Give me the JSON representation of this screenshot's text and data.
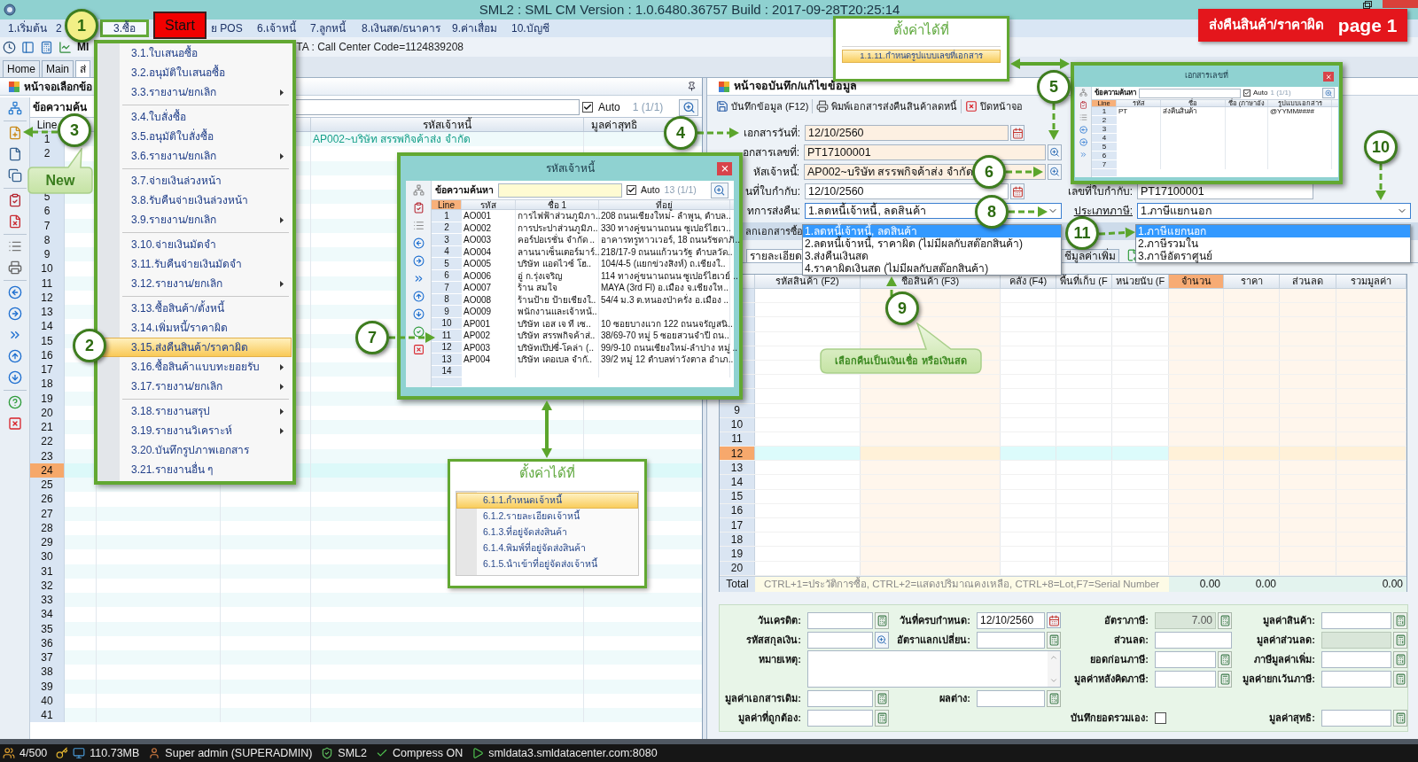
{
  "window": {
    "title": "SML2 : SML CM Version : 1.0.6480.36757 Build : 2017-09-28T20:25:14"
  },
  "menu_bar": [
    {
      "label": "1.เริ่มต้น",
      "selected": false
    },
    {
      "label": "2",
      "selected": false
    },
    {
      "label": "3.ซื้อ",
      "selected": true
    },
    {
      "label": "ย POS",
      "selected": false
    },
    {
      "label": "6.เจ้าหนี้",
      "selected": false
    },
    {
      "label": "7.ลูกหนี้",
      "selected": false
    },
    {
      "label": "8.เงินสด/ธนาคาร",
      "selected": false
    },
    {
      "label": "9.ค่าเสื่อม",
      "selected": false
    },
    {
      "label": "10.บัญชี",
      "selected": false
    }
  ],
  "toolbar": {
    "label": "MI",
    "info": "TA : Call Center Code=1124839208"
  },
  "tabs": [
    {
      "label": "Home",
      "selected": false
    },
    {
      "label": "Main",
      "selected": false
    },
    {
      "label": "ส่",
      "selected": true
    }
  ],
  "purchase_menu": [
    [
      {
        "label": "3.1.ใบเสนอซื้อ",
        "submenu": false,
        "selected": false
      },
      {
        "label": "3.2.อนุมัติใบเสนอซื้อ",
        "submenu": false,
        "selected": false
      },
      {
        "label": "3.3.รายงาน/ยกเลิก",
        "submenu": true,
        "selected": false
      }
    ],
    [
      {
        "label": "3.4.ใบสั่งซื้อ",
        "submenu": false,
        "selected": false
      },
      {
        "label": "3.5.อนุมัติใบสั่งซื้อ",
        "submenu": false,
        "selected": false
      },
      {
        "label": "3.6.รายงาน/ยกเลิก",
        "submenu": true,
        "selected": false
      }
    ],
    [
      {
        "label": "3.7.จ่ายเงินล่วงหน้า",
        "submenu": false,
        "selected": false
      },
      {
        "label": "3.8.รับคืนจ่ายเงินล่วงหน้า",
        "submenu": false,
        "selected": false
      },
      {
        "label": "3.9.รายงาน/ยกเลิก",
        "submenu": true,
        "selected": false
      }
    ],
    [
      {
        "label": "3.10.จ่ายเงินมัดจำ",
        "submenu": false,
        "selected": false
      },
      {
        "label": "3.11.รับคืนจ่ายเงินมัดจำ",
        "submenu": false,
        "selected": false
      },
      {
        "label": "3.12.รายงาน/ยกเลิก",
        "submenu": true,
        "selected": false
      }
    ],
    [
      {
        "label": "3.13.ซื้อสินค้า/ตั้งหนี้",
        "submenu": false,
        "selected": false
      },
      {
        "label": "3.14.เพิ่มหนี้/ราคาผิด",
        "submenu": false,
        "selected": false
      },
      {
        "label": "3.15.ส่งคืนสินค้า/ราคาผิด",
        "submenu": false,
        "selected": true
      },
      {
        "label": "3.16.ซื้อสินค้าแบบทะยอยรับ",
        "submenu": true,
        "selected": false
      },
      {
        "label": "3.17.รายงาน/ยกเลิก",
        "submenu": true,
        "selected": false
      }
    ],
    [
      {
        "label": "3.18.รายงานสรุป",
        "submenu": true,
        "selected": false
      },
      {
        "label": "3.19.รายงานวิเคราะห์",
        "submenu": true,
        "selected": false
      },
      {
        "label": "3.20.บันทึกรูปภาพเอกสาร",
        "submenu": false,
        "selected": false
      },
      {
        "label": "3.21.รายงานอื่น ๆ",
        "submenu": false,
        "selected": false
      }
    ]
  ],
  "left_panel": {
    "title": "หน้าจอเลือกข้อ",
    "search_label": "ข้อความค้น",
    "auto": {
      "label": "Auto",
      "checked": true
    },
    "count": "1 (1/1)",
    "columns": [
      "Line",
      "รหัสเจ้าหนี้",
      "มูลค่าสุทธิ"
    ],
    "rows": [
      {
        "line": "1",
        "supplier": "AP002~บริษัท สรรพกิจค้าส่ง จำกัด",
        "selected": false
      },
      {
        "line": "2",
        "selected": false
      },
      {
        "selected": false
      },
      {
        "selected": false
      },
      {
        "line": "5",
        "selected": false
      },
      {
        "line": "6",
        "selected": false
      },
      {
        "line": "7",
        "selected": false
      },
      {
        "line": "8",
        "selected": false
      },
      {
        "line": "9",
        "selected": false
      },
      {
        "line": "10",
        "selected": false
      },
      {
        "line": "11",
        "selected": false
      },
      {
        "line": "12",
        "selected": false
      },
      {
        "line": "13",
        "selected": false
      },
      {
        "line": "14",
        "selected": false
      },
      {
        "line": "15",
        "selected": false
      },
      {
        "line": "16",
        "selected": false
      },
      {
        "line": "17",
        "selected": false
      },
      {
        "line": "18",
        "selected": false
      },
      {
        "line": "19",
        "selected": false
      },
      {
        "line": "20",
        "selected": false
      },
      {
        "line": "21",
        "selected": false
      },
      {
        "line": "22",
        "selected": false
      },
      {
        "line": "23",
        "selected": false
      },
      {
        "line": "24",
        "selected": true
      },
      {
        "line": "25",
        "selected": false
      },
      {
        "line": "26",
        "selected": false
      },
      {
        "line": "27",
        "selected": false
      },
      {
        "line": "28",
        "selected": false
      },
      {
        "line": "29",
        "selected": false
      },
      {
        "line": "30",
        "selected": false
      },
      {
        "line": "31",
        "selected": false
      },
      {
        "line": "32",
        "selected": false
      },
      {
        "line": "33",
        "selected": false
      },
      {
        "line": "34",
        "selected": false
      },
      {
        "line": "35",
        "selected": false
      },
      {
        "line": "36",
        "selected": false
      },
      {
        "line": "37",
        "selected": false
      },
      {
        "line": "38",
        "selected": false
      },
      {
        "line": "39",
        "selected": false
      },
      {
        "line": "40",
        "selected": false
      },
      {
        "line": "41",
        "selected": false
      }
    ]
  },
  "editor": {
    "title": "หน้าจอบันทึก/แก้ไขข้อมูล",
    "actions": [
      {
        "label": "บันทึกข้อมูล (F12)",
        "kind": "save"
      },
      {
        "label": "พิมพ์เอกสารส่งคืนสินค้าลดหนี้",
        "kind": "print"
      },
      {
        "label": "ปิดหน้าจอ",
        "kind": "close"
      }
    ],
    "fields": [
      {
        "label": "เอกสารวันที่:",
        "value": "12/10/2560",
        "kind": "date",
        "required": true
      },
      {
        "label": "อกสารเลขที่:",
        "value": "PT17100001",
        "kind": "lookup",
        "required": true
      },
      {
        "label": "หัสเจ้าหนี้:",
        "value": "AP002~บริษัท สรรพกิจค้าส่ง จำกัด",
        "kind": "lookup",
        "required": true
      },
      {
        "label": "นที่ใบกำกับ:",
        "value": "12/10/2560",
        "kind": "date",
        "required": false
      },
      {
        "label": "ทการส่งคืน:",
        "value": "1.ลดหนี้เจ้าหนี้, ลดสินค้า",
        "kind": "dropdown",
        "required": false,
        "expanded": true,
        "options": [
          {
            "label": "1.ลดหนี้เจ้าหนี้, ลดสินค้า",
            "selected": true
          },
          {
            "label": "2.ลดหนี้เจ้าหนี้, ราคาผิด (ไม่มีผลกับสต๊อกสินค้า)",
            "selected": false
          },
          {
            "label": "3.ส่งคืนเงินสด",
            "selected": false
          },
          {
            "label": "4.ราคาผิดเงินสด (ไม่มีผลกับสต๊อกสินค้า)",
            "selected": false
          }
        ]
      }
    ],
    "invoice": {
      "label": "เลขที่ใบกำกับ:",
      "value": "PT17100001"
    },
    "tax_type": {
      "label": "ประเภทภาษี:",
      "value": "1.ภาษีแยกนอก",
      "expanded": true,
      "options": [
        {
          "label": "1.ภาษีแยกนอก",
          "selected": true
        },
        {
          "label": "2.ภาษีรวมใน",
          "selected": false
        },
        {
          "label": "3.ภาษีอัตราศูนย์",
          "selected": false
        }
      ]
    },
    "section_label": "ลกเอกสารซื้อ",
    "detail_tabs": [
      {
        "label": "รายละเอียด",
        "selected": true
      },
      {
        "label": "ชีมูลค่าเพิ่ม",
        "selected": false
      }
    ],
    "grid": {
      "columns": [
        {
          "label": "รหัสสินค้า (F2)",
          "selected": false
        },
        {
          "label": "ชื่อสินค้า (F3)",
          "selected": false
        },
        {
          "label": "คลัง (F4)",
          "selected": false
        },
        {
          "label": "พื้นที่เก็บ (F",
          "selected": false
        },
        {
          "label": "หน่วยนับ (F",
          "selected": false
        },
        {
          "label": "จำนวน",
          "selected": true
        },
        {
          "label": "ราคา",
          "selected": false
        },
        {
          "label": "ส่วนลด",
          "selected": false
        },
        {
          "label": "รวมมูลค่า",
          "selected": false
        }
      ],
      "rows": [
        {
          "selected": false
        },
        {
          "selected": false
        },
        {
          "selected": false
        },
        {
          "selected": false
        },
        {
          "selected": false
        },
        {
          "selected": false
        },
        {
          "selected": false
        },
        {
          "selected": false
        },
        {
          "line": "9",
          "selected": false
        },
        {
          "line": "10",
          "selected": false
        },
        {
          "line": "11",
          "selected": false
        },
        {
          "line": "12",
          "selected": true
        },
        {
          "line": "13",
          "selected": false
        },
        {
          "line": "14",
          "selected": false
        },
        {
          "line": "15",
          "selected": false
        },
        {
          "line": "16",
          "selected": false
        },
        {
          "line": "17",
          "selected": false
        },
        {
          "line": "18",
          "selected": false
        },
        {
          "line": "19",
          "selected": false
        },
        {
          "line": "20",
          "selected": false
        }
      ],
      "total": {
        "label": "Total",
        "hint": "CTRL+1=ประวัติการซื้อ, CTRL+2=แสดงปริมาณคงเหลือ, CTRL+8=Lot,F7=Serial Number",
        "quantity": "0.00",
        "price": "0.00",
        "amount": "0.00"
      }
    },
    "summary": [
      {
        "label": "วันเครดิต:",
        "kind": "calc",
        "disabled": false
      },
      {
        "label": "วันที่ครบกำหนด:",
        "kind": "date",
        "value": "12/10/2560",
        "disabled": false
      },
      {
        "label": "อัตราภาษี:",
        "kind": "calc",
        "value": "7.00",
        "disabled": true
      },
      {
        "label": "มูลค่าสินค้า:",
        "kind": "calc",
        "disabled": false
      },
      {
        "label": "รหัสสกุลเงิน:",
        "kind": "search",
        "disabled": false
      },
      {
        "label": "อัตราแลกเปลี่ยน:",
        "kind": "calc",
        "disabled": false
      },
      {
        "label": "ส่วนลด:",
        "kind": "plain",
        "disabled": false
      },
      {
        "label": "มูลค่าส่วนลด:",
        "kind": "calc",
        "disabled": true
      },
      {
        "label": "หมายเหตุ:",
        "kind": "textarea",
        "disabled": false
      },
      {
        "label": "ยอดก่อนภาษี:",
        "kind": "calc",
        "disabled": false
      },
      {
        "label": "ภาษีมูลค่าเพิ่ม:",
        "kind": "calc",
        "disabled": false
      },
      {
        "label": "มูลค่าหลังคิดภาษี:",
        "kind": "calc",
        "disabled": false
      },
      {
        "label": "มูลค่ายกเว้นภาษี:",
        "kind": "calc",
        "disabled": false
      },
      {
        "label": "มูลค่าเอกสารเดิม:",
        "kind": "calc",
        "disabled": false
      },
      {
        "label": "ผลต่าง:",
        "kind": "calc",
        "disabled": false
      },
      {
        "label": "มูลค่าที่ถูกต้อง:",
        "kind": "calc",
        "disabled": false
      },
      {
        "label": "บันทึกยอดรวมเอง:",
        "kind": "checkbox",
        "checked": false,
        "disabled": false
      },
      {
        "label": "มูลค่าสุทธิ:",
        "kind": "calc",
        "disabled": false
      }
    ]
  },
  "lookup_windows": [
    {
      "title": "รหัสเจ้าหนี้",
      "search_label": "ข้อความค้นหา",
      "auto": {
        "label": "Auto",
        "checked": true
      },
      "count": "13 (1/1)",
      "columns": [
        "Line",
        "รหัส",
        "ชื่อ 1",
        "ที่อยู่"
      ],
      "rows": [
        {
          "line": "1",
          "code": "AO001",
          "name": "การไฟฟ้าส่วนภูมิภา..",
          "address": "208 ถนนเชียงใหม่- ลำพูน, ตำบล.."
        },
        {
          "line": "2",
          "code": "AO002",
          "name": "การประปาส่วนภูมิภ..",
          "address": "330 ทางคู่ขนานถนน ซูเปอร์ไฮเว.."
        },
        {
          "line": "3",
          "code": "AO003",
          "name": "คอร์ปอเรชั่น จำกัด ..",
          "address": "อาคารทรูทาวเวอร์, 18 ถนนรัชดาภิ.."
        },
        {
          "line": "4",
          "code": "AO004",
          "name": "ลานนาเซ็นเตอร์มาร์..",
          "address": "218/17-9 ถนนแก้วนวรัฐ ตำบลวัด.."
        },
        {
          "line": "5",
          "code": "AO005",
          "name": "บริษัท แอดไวซ์ โฮ..",
          "address": "104/4-5 (แยกข่วงสิงห์) ถ.เชียงใ.."
        },
        {
          "line": "6",
          "code": "AO006",
          "name": "อู่ ก.รุ่งเจริญ",
          "address": "114 ทางคู่ขนานถนน ซูเปอร์ไฮเวย์ .."
        },
        {
          "line": "7",
          "code": "AO007",
          "name": "ร้าน สมใจ",
          "address": "MAYA (3rd Fl) อ.เมือง จ.เชียงให.."
        },
        {
          "line": "8",
          "code": "AO008",
          "name": "ร้านป้าย ป้ายเชียงใ..",
          "address": "54/4 ม.3 ต.หนองป่าครั่ง อ.เมือง .."
        },
        {
          "line": "9",
          "code": "AO009",
          "name": "พนักงานและเจ้าหน้.."
        },
        {
          "line": "10",
          "code": "AP001",
          "name": "บริษัท เอส เจ ที เซ..",
          "address": "10 ซอยบางแวก 122 ถนนจรัญสนิ.."
        },
        {
          "line": "11",
          "code": "AP002",
          "name": "บริษัท สรรพกิจค้าส่..",
          "address": "38/69-70 หมู่ 5 ซอยสวนจำปี ถน.."
        },
        {
          "line": "12",
          "code": "AP003",
          "name": "บริษัทเป๊ปซี่-โคล่า (..",
          "address": "99/9-10 ถนนเชียงใหม่-ลำปาง หมู่ .."
        },
        {
          "line": "13",
          "code": "AP004",
          "name": "บริษัท เดอเบล จำกั..",
          "address": "39/2 หมู่ 12 ตำบลท่าวังตาล อำเภ.."
        },
        {
          "line": "14"
        }
      ]
    },
    {
      "title": "เอกสารเลขที่",
      "search_label": "ข้อความค้นหา",
      "auto": {
        "label": "Auto",
        "checked": true
      },
      "count": "1 (1/1)",
      "columns": [
        "Line",
        "รหัส",
        "ชื่อ",
        "ชื่อ (ภาษาอัง",
        "รูปแบบเอกสาร"
      ],
      "rows": [
        {
          "line": "1",
          "code": "PT",
          "name": "ส่งคืนสินค้า",
          "format": "@YYMM####"
        },
        {
          "line": "2"
        },
        {
          "line": "3"
        },
        {
          "line": "4"
        },
        {
          "line": "5"
        },
        {
          "line": "6"
        },
        {
          "line": "7"
        }
      ]
    }
  ],
  "settings_boxes": [
    {
      "title": "ตั้งค่าได้ที่",
      "items": [
        {
          "label": "1.1.11.กำหนดรูปแบบเลขที่เอกสาร",
          "selected": true
        }
      ]
    },
    {
      "title": "ตั้งค่าได้ที่",
      "items": [
        {
          "label": "6.1.1.กำหนดเจ้าหนี้",
          "selected": true
        },
        {
          "label": "6.1.2.รายละเอียดเจ้าหนี้",
          "selected": false
        },
        {
          "label": "6.1.3.ที่อยู่จัดส่งสินค้า",
          "selected": false
        },
        {
          "label": "6.1.4.พิมพ์ที่อยู่จัดส่งสินค้า",
          "selected": false
        },
        {
          "label": "6.1.5.นำเข้าที่อยู่จัดส่งเจ้าหนี้",
          "selected": false
        }
      ]
    }
  ],
  "callouts": {
    "markers": [
      {
        "number": "1",
        "color": "#f2ef86"
      },
      {
        "number": "2",
        "color": "#ffffff"
      },
      {
        "number": "3",
        "color": "#ffffff"
      },
      {
        "number": "4",
        "color": "#ffffff"
      },
      {
        "number": "5",
        "color": "#ffffff"
      },
      {
        "number": "6",
        "color": "#ffffff"
      },
      {
        "number": "7",
        "color": "#ffffff"
      },
      {
        "number": "8",
        "color": "#ffffff"
      },
      {
        "number": "9",
        "color": "#ffffff"
      },
      {
        "number": "10",
        "color": "#ffffff"
      },
      {
        "number": "11",
        "color": "#ffffff"
      }
    ],
    "start": "Start",
    "new_note": "New",
    "return_note": "เลือกคืนเป็นเงินเชื่อ หรือเงินสด"
  },
  "banner": {
    "title": "ส่งคืนสินค้า/ราคาผิด",
    "page": "page 1"
  },
  "status_bar": [
    "4/500",
    "110.73MB",
    "Super admin (SUPERADMIN)",
    "SML2",
    "Compress ON",
    "smldata3.smldatacenter.com:8080"
  ]
}
